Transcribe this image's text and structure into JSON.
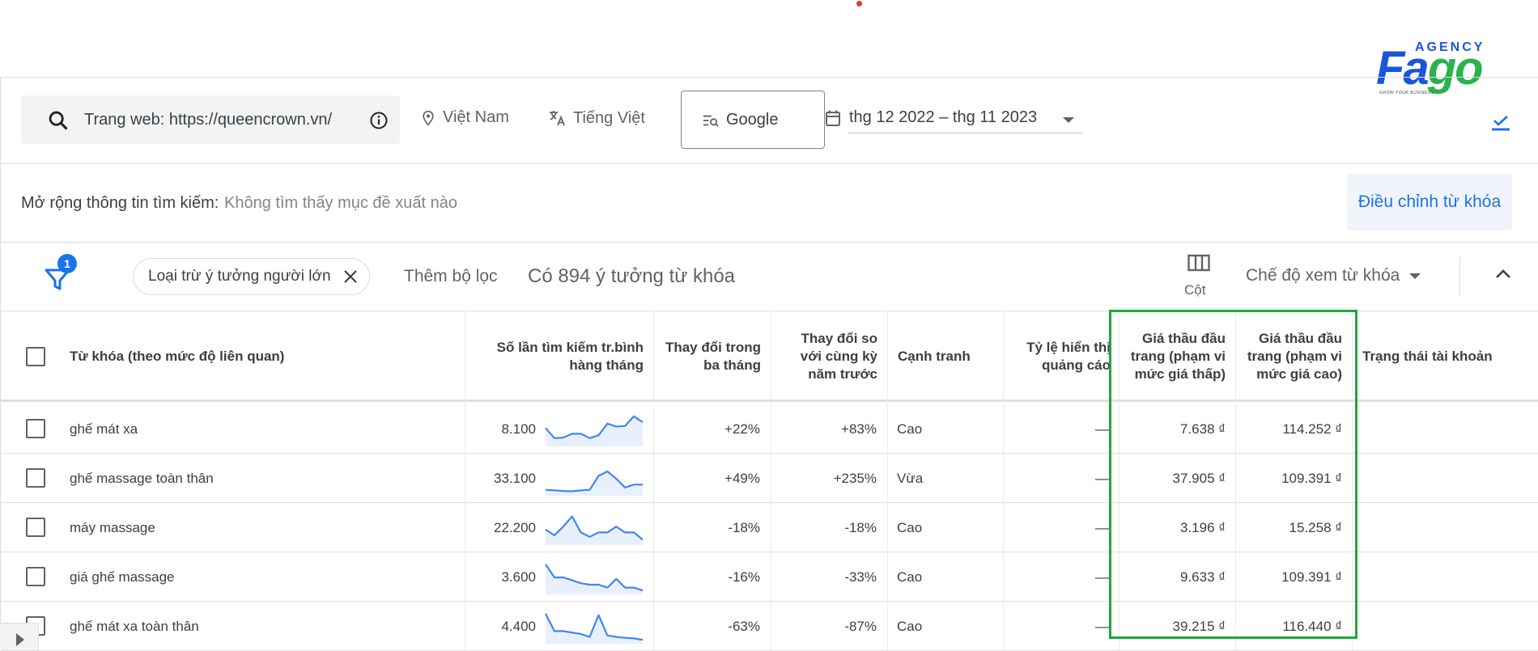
{
  "logo": {
    "top": "AGENCY",
    "word_a": "Fa",
    "word_b": "go",
    "tagline": "GROW YOUR BUSINESS"
  },
  "topbar": {
    "search_text": "Trang web: https://queencrown.vn/",
    "location": "Việt Nam",
    "language": "Tiếng Việt",
    "engine": "Google",
    "date_range": "thg 12 2022 – thg 11 2023"
  },
  "expand": {
    "label": "Mở rộng thông tin tìm kiếm:",
    "value": "Không tìm thấy mục đề xuất nào",
    "refine_button": "Điều chỉnh từ khóa"
  },
  "filters": {
    "badge_count": "1",
    "chip_label": "Loại trừ ý tưởng người lớn",
    "add_filter": "Thêm bộ lọc",
    "idea_count": "Có 894 ý tưởng từ khóa",
    "columns_label": "Cột",
    "view_mode": "Chế độ xem từ khóa"
  },
  "table": {
    "headers": {
      "keyword": "Từ khóa (theo mức độ liên quan)",
      "avg_searches_1": "Số lần tìm kiếm tr.bình",
      "avg_searches_2": "hàng tháng",
      "three_month_1": "Thay đổi trong",
      "three_month_2": "ba tháng",
      "yoy_1": "Thay đổi so",
      "yoy_2": "với cùng kỳ",
      "yoy_3": "năm trước",
      "competition": "Cạnh tranh",
      "impr_share_1": "Tỷ lệ hiển thị",
      "impr_share_2": "quảng cáo",
      "bid_low_1": "Giá thầu đầu",
      "bid_low_2": "trang (phạm vi",
      "bid_low_3": "mức giá thấp)",
      "bid_high_1": "Giá thầu đầu",
      "bid_high_2": "trang (phạm vi",
      "bid_high_3": "mức giá cao)",
      "account_status": "Trạng thái tài khoản"
    },
    "rows": [
      {
        "keyword": "ghế mát xa",
        "searches": "8.100",
        "three_month": "+22%",
        "yoy": "+83%",
        "competition": "Cao",
        "impr_share": "—",
        "bid_low": "7.638 ₫",
        "bid_high": "114.252 ₫",
        "trend": [
          0.55,
          0.2,
          0.22,
          0.35,
          0.35,
          0.2,
          0.3,
          0.7,
          0.6,
          0.62,
          0.95,
          0.75
        ]
      },
      {
        "keyword": "ghế massage toàn thân",
        "searches": "33.100",
        "three_month": "+49%",
        "yoy": "+235%",
        "competition": "Vừa",
        "impr_share": "—",
        "bid_low": "37.905 ₫",
        "bid_high": "109.391 ₫",
        "trend": [
          0.12,
          0.1,
          0.08,
          0.07,
          0.1,
          0.12,
          0.6,
          0.75,
          0.5,
          0.2,
          0.3,
          0.3
        ]
      },
      {
        "keyword": "máy massage",
        "searches": "22.200",
        "three_month": "-18%",
        "yoy": "-18%",
        "competition": "Cao",
        "impr_share": "—",
        "bid_low": "3.196 ₫",
        "bid_high": "15.258 ₫",
        "trend": [
          0.45,
          0.25,
          0.55,
          0.9,
          0.35,
          0.2,
          0.35,
          0.35,
          0.55,
          0.35,
          0.35,
          0.1
        ]
      },
      {
        "keyword": "giá ghế massage",
        "searches": "3.600",
        "three_month": "-16%",
        "yoy": "-33%",
        "competition": "Cao",
        "impr_share": "—",
        "bid_low": "9.633 ₫",
        "bid_high": "109.391 ₫",
        "trend": [
          0.95,
          0.5,
          0.5,
          0.4,
          0.3,
          0.25,
          0.25,
          0.15,
          0.45,
          0.15,
          0.15,
          0.05
        ]
      },
      {
        "keyword": "ghế mát xa toàn thân",
        "searches": "4.400",
        "three_month": "-63%",
        "yoy": "-87%",
        "competition": "Cao",
        "impr_share": "—",
        "bid_low": "39.215 ₫",
        "bid_high": "116.440 ₫",
        "trend": [
          0.95,
          0.35,
          0.35,
          0.3,
          0.25,
          0.15,
          0.9,
          0.2,
          0.15,
          0.12,
          0.1,
          0.05
        ]
      }
    ]
  },
  "colors": {
    "accent": "#1a73e8",
    "spark_line": "#4285f4",
    "spark_fill": "#e8f0fe",
    "highlight": "#1fa83a"
  }
}
